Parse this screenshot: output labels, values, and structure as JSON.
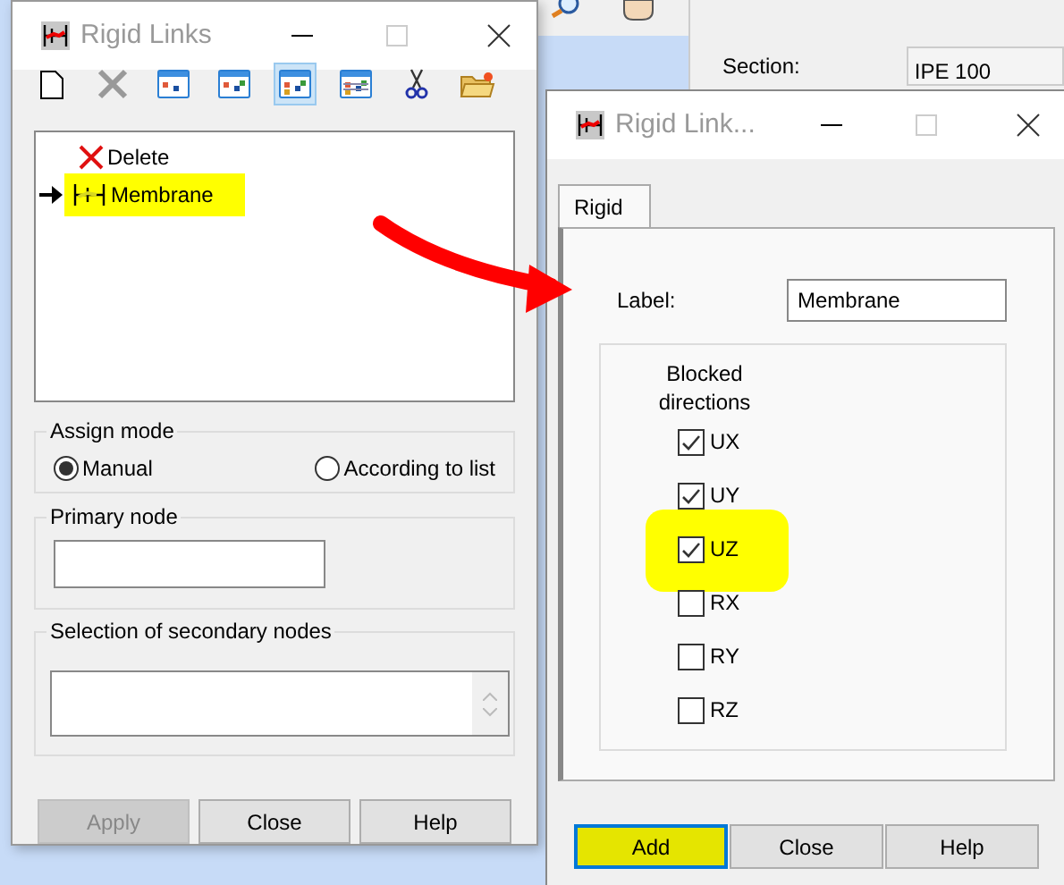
{
  "background": {
    "section_label": "Section:",
    "section_value": "IPE 100"
  },
  "left_window": {
    "title": "Rigid Links",
    "toolbar": [
      {
        "kind": "new",
        "selected": false
      },
      {
        "kind": "delete",
        "selected": false
      },
      {
        "kind": "view1",
        "selected": false
      },
      {
        "kind": "view2",
        "selected": false
      },
      {
        "kind": "view3",
        "selected": true
      },
      {
        "kind": "view4",
        "selected": false
      },
      {
        "kind": "cut",
        "selected": false
      },
      {
        "kind": "open",
        "selected": false
      }
    ],
    "list": [
      {
        "label": "Delete",
        "kind": "delete",
        "current": false,
        "highlighted": false
      },
      {
        "label": "Membrane",
        "kind": "link",
        "current": true,
        "highlighted": true
      }
    ],
    "assign_mode": {
      "title": "Assign mode",
      "options": [
        {
          "label": "Manual",
          "selected": true
        },
        {
          "label": "According to list",
          "selected": false
        }
      ]
    },
    "primary_node": {
      "title": "Primary node"
    },
    "secondary_nodes": {
      "title": "Selection of secondary nodes"
    },
    "buttons": [
      {
        "label": "Apply",
        "disabled": true
      },
      {
        "label": "Close",
        "disabled": false
      },
      {
        "label": "Help",
        "disabled": false
      }
    ]
  },
  "right_window": {
    "title": "Rigid Link...",
    "tabs": [
      {
        "label": "Rigid",
        "selected": true
      }
    ],
    "label_field": {
      "label": "Label:",
      "value": "Membrane"
    },
    "group_title": "Blocked directions",
    "directions": [
      {
        "label": "UX",
        "checked": true,
        "highlighted": false
      },
      {
        "label": "UY",
        "checked": true,
        "highlighted": false
      },
      {
        "label": "UZ",
        "checked": true,
        "highlighted": true
      },
      {
        "label": "RX",
        "checked": false,
        "highlighted": false
      },
      {
        "label": "RY",
        "checked": false,
        "highlighted": false
      },
      {
        "label": "RZ",
        "checked": false,
        "highlighted": false
      }
    ],
    "buttons": [
      {
        "label": "Add",
        "default": true,
        "highlighted": true
      },
      {
        "label": "Close",
        "default": false,
        "highlighted": false
      },
      {
        "label": "Help",
        "default": false,
        "highlighted": false
      }
    ]
  }
}
